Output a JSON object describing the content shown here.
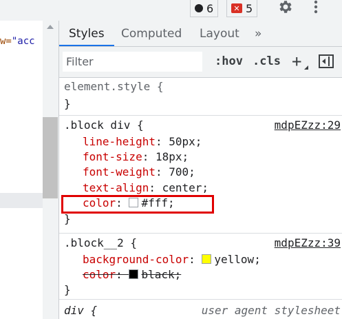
{
  "toolbar": {
    "messages_count": "6",
    "errors_count": "5",
    "settings_icon": "gear-icon",
    "more_icon": "kebab-menu-icon"
  },
  "elements_pane": {
    "code_fragment_attr": "w=",
    "code_fragment_value": "\"acc"
  },
  "tabs": [
    {
      "label": "Styles",
      "active": true
    },
    {
      "label": "Computed"
    },
    {
      "label": "Layout"
    },
    {
      "label": "»"
    }
  ],
  "filter": {
    "placeholder": "Filter",
    "hov_label": ":hov",
    "cls_label": ".cls",
    "add_label": "+"
  },
  "rules": {
    "element_style": {
      "selector": "element.style {",
      "close": "}"
    },
    "block_div": {
      "selector": ".block div {",
      "source": "mdpEZzz:29",
      "declarations": [
        {
          "prop": "line-height",
          "value": "50px;"
        },
        {
          "prop": "font-size",
          "value": "18px;"
        },
        {
          "prop": "font-weight",
          "value": "700;"
        },
        {
          "prop": "text-align",
          "value": "center;"
        },
        {
          "prop": "color",
          "value": "#fff;",
          "swatch": "#ffffff"
        }
      ],
      "close": "}"
    },
    "block_2": {
      "selector": ".block__2 {",
      "source": "mdpEZzz:39",
      "declarations": [
        {
          "prop": "background-color",
          "value": "yellow;",
          "swatch": "#ffff00"
        },
        {
          "prop": "color",
          "value": "black;",
          "swatch": "#000000",
          "overridden": true
        }
      ],
      "close": "}"
    },
    "ua_div": {
      "selector": "div {",
      "source": "user agent stylesheet"
    }
  },
  "colors": {
    "accent": "#1a73e8",
    "error_badge": "#d93025",
    "highlight_box": "#e00000",
    "property_name": "#c80000"
  }
}
